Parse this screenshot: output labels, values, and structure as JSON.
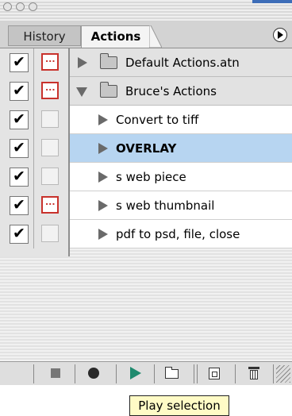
{
  "tabs": [
    {
      "label": "History",
      "active": false
    },
    {
      "label": "Actions",
      "active": true
    }
  ],
  "rows": [
    {
      "label": "Default Actions.atn",
      "type": "set",
      "expanded": false,
      "checked": true,
      "dialog": true,
      "selected": false
    },
    {
      "label": "Bruce's Actions",
      "type": "set",
      "expanded": true,
      "checked": true,
      "dialog": true,
      "selected": false
    },
    {
      "label": "Convert to tiff",
      "type": "action",
      "expanded": false,
      "checked": true,
      "dialog": false,
      "selected": false
    },
    {
      "label": "OVERLAY",
      "type": "action",
      "expanded": false,
      "checked": true,
      "dialog": false,
      "selected": true
    },
    {
      "label": "s web piece",
      "type": "action",
      "expanded": false,
      "checked": true,
      "dialog": false,
      "selected": false
    },
    {
      "label": "s web thumbnail",
      "type": "action",
      "expanded": false,
      "checked": true,
      "dialog": true,
      "selected": false
    },
    {
      "label": "pdf to psd, file, close",
      "type": "action",
      "expanded": false,
      "checked": true,
      "dialog": false,
      "selected": false
    }
  ],
  "toolbar": {
    "buttons": [
      {
        "icon": "stop-icon",
        "title": "Stop playing/recording"
      },
      {
        "icon": "record-icon",
        "title": "Begin recording"
      },
      {
        "icon": "play-icon",
        "title": "Play selection"
      },
      {
        "icon": "folder-icon",
        "title": "Create new set"
      },
      {
        "icon": "new-action-icon",
        "title": "Create new action"
      },
      {
        "icon": "trash-icon",
        "title": "Delete"
      }
    ]
  },
  "tooltip": {
    "text": "Play selection"
  },
  "colors": {
    "selection": "#b7d5f1",
    "play_icon": "#1f8a6e",
    "dialog_toggle": "#c8322c",
    "tooltip_bg": "#fffbc6"
  }
}
